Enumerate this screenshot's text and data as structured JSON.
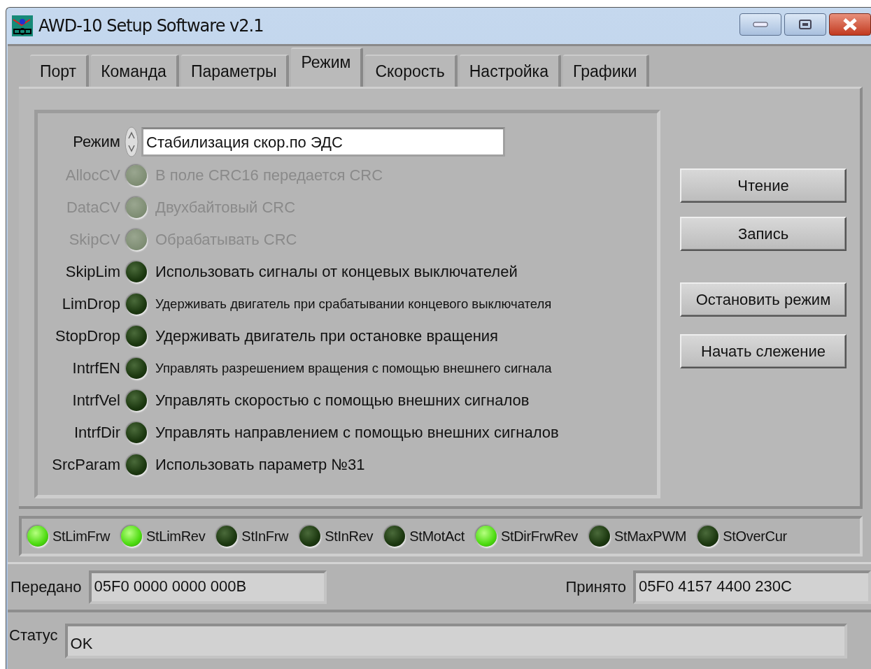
{
  "window": {
    "title": "AWD-10 Setup Software v2.1"
  },
  "tabs": [
    {
      "label": "Порт",
      "selected": false
    },
    {
      "label": "Команда",
      "selected": false
    },
    {
      "label": "Параметры",
      "selected": false
    },
    {
      "label": "Режим",
      "selected": true
    },
    {
      "label": "Скорость",
      "selected": false
    },
    {
      "label": "Настройка",
      "selected": false
    },
    {
      "label": "Графики",
      "selected": false
    }
  ],
  "mode": {
    "label": "Режим",
    "value": "Стабилизация скор.по ЭДС"
  },
  "flags": [
    {
      "name": "AllocCV",
      "description": "В поле CRC16 передается CRC",
      "on": false,
      "disabled": true
    },
    {
      "name": "DataCV",
      "description": "Двухбайтовый CRC",
      "on": false,
      "disabled": true
    },
    {
      "name": "SkipCV",
      "description": "Обрабатывать CRC",
      "on": false,
      "disabled": true
    },
    {
      "name": "SkipLim",
      "description": "Использовать сигналы от концевых выключателей",
      "on": false,
      "disabled": false
    },
    {
      "name": "LimDrop",
      "description": "Удерживать двигатель при срабатывании концевого выключателя",
      "on": false,
      "disabled": false
    },
    {
      "name": "StopDrop",
      "description": "Удерживать двигатель при остановке вращения",
      "on": false,
      "disabled": false
    },
    {
      "name": "IntrfEN",
      "description": "Управлять разрешением вращения с помощью внешнего сигнала",
      "on": false,
      "disabled": false
    },
    {
      "name": "IntrfVel",
      "description": "Управлять скоростью с помощью внешних сигналов",
      "on": false,
      "disabled": false
    },
    {
      "name": "IntrfDir",
      "description": "Управлять направлением с помощью внешних сигналов",
      "on": false,
      "disabled": false
    },
    {
      "name": "SrcParam",
      "description": "Использовать параметр №31",
      "on": false,
      "disabled": false
    }
  ],
  "buttons": [
    "Чтение",
    "Запись",
    "Остановить режим",
    "Начать слежение"
  ],
  "status_leds": [
    {
      "label": "StLimFrw",
      "on": true
    },
    {
      "label": "StLimRev",
      "on": true
    },
    {
      "label": "StInFrw",
      "on": false
    },
    {
      "label": "StInRev",
      "on": false
    },
    {
      "label": "StMotAct",
      "on": false
    },
    {
      "label": "StDirFrwRev",
      "on": true
    },
    {
      "label": "StMaxPWM",
      "on": false
    },
    {
      "label": "StOverCur",
      "on": false
    }
  ],
  "sent": {
    "label": "Передано",
    "value": "05F0 0000 0000 000B"
  },
  "received": {
    "label": "Принято",
    "value": "05F0 4157 4400 230C"
  },
  "status": {
    "label": "Статус",
    "value": "OK"
  }
}
